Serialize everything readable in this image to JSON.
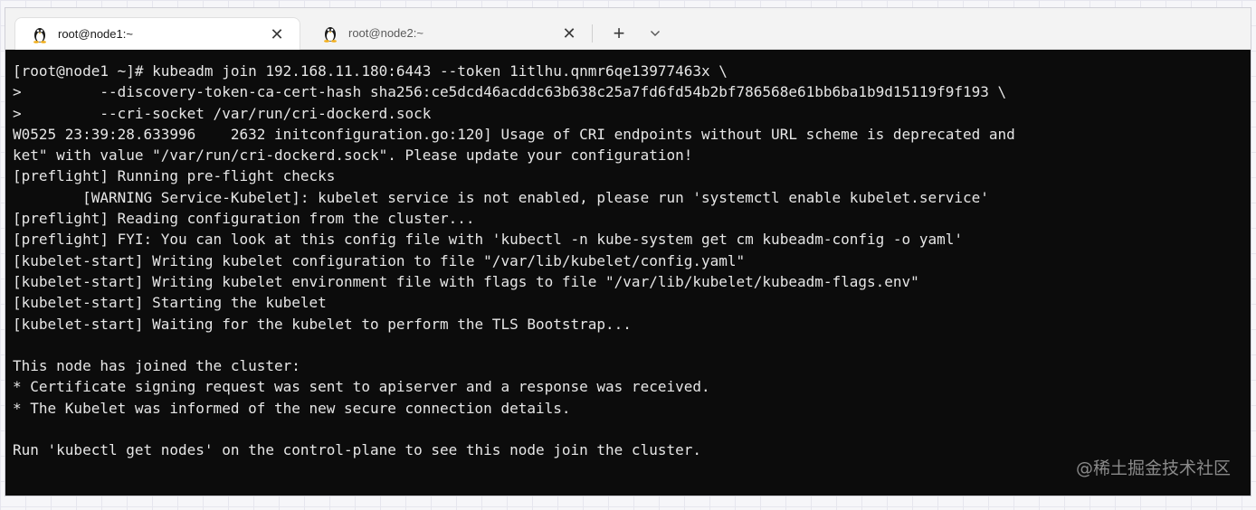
{
  "tabs": [
    {
      "title": "root@node1:~",
      "active": true,
      "icon": "linux-tux-icon"
    },
    {
      "title": "root@node2:~",
      "active": false,
      "icon": "linux-tux-icon"
    }
  ],
  "tab_close_glyph": "✕",
  "new_tab_glyph": "+",
  "terminal": {
    "lines": [
      "[root@node1 ~]# kubeadm join 192.168.11.180:6443 --token 1itlhu.qnmr6qe13977463x \\",
      ">         --discovery-token-ca-cert-hash sha256:ce5dcd46acddc63b638c25a7fd6fd54b2bf786568e61bb6ba1b9d15119f9f193 \\",
      ">         --cri-socket /var/run/cri-dockerd.sock",
      "W0525 23:39:28.633996    2632 initconfiguration.go:120] Usage of CRI endpoints without URL scheme is deprecated and",
      "ket\" with value \"/var/run/cri-dockerd.sock\". Please update your configuration!",
      "[preflight] Running pre-flight checks",
      "        [WARNING Service-Kubelet]: kubelet service is not enabled, please run 'systemctl enable kubelet.service'",
      "[preflight] Reading configuration from the cluster...",
      "[preflight] FYI: You can look at this config file with 'kubectl -n kube-system get cm kubeadm-config -o yaml'",
      "[kubelet-start] Writing kubelet configuration to file \"/var/lib/kubelet/config.yaml\"",
      "[kubelet-start] Writing kubelet environment file with flags to file \"/var/lib/kubelet/kubeadm-flags.env\"",
      "[kubelet-start] Starting the kubelet",
      "[kubelet-start] Waiting for the kubelet to perform the TLS Bootstrap...",
      "",
      "This node has joined the cluster:",
      "* Certificate signing request was sent to apiserver and a response was received.",
      "* The Kubelet was informed of the new secure connection details.",
      "",
      "Run 'kubectl get nodes' on the control-plane to see this node join the cluster."
    ]
  },
  "watermark": "@稀土掘金技术社区",
  "colors": {
    "terminal_bg": "#0c0c0c",
    "terminal_fg": "#e6e6e6",
    "tabbar_bg": "#f3f3f3",
    "active_tab_bg": "#ffffff"
  }
}
